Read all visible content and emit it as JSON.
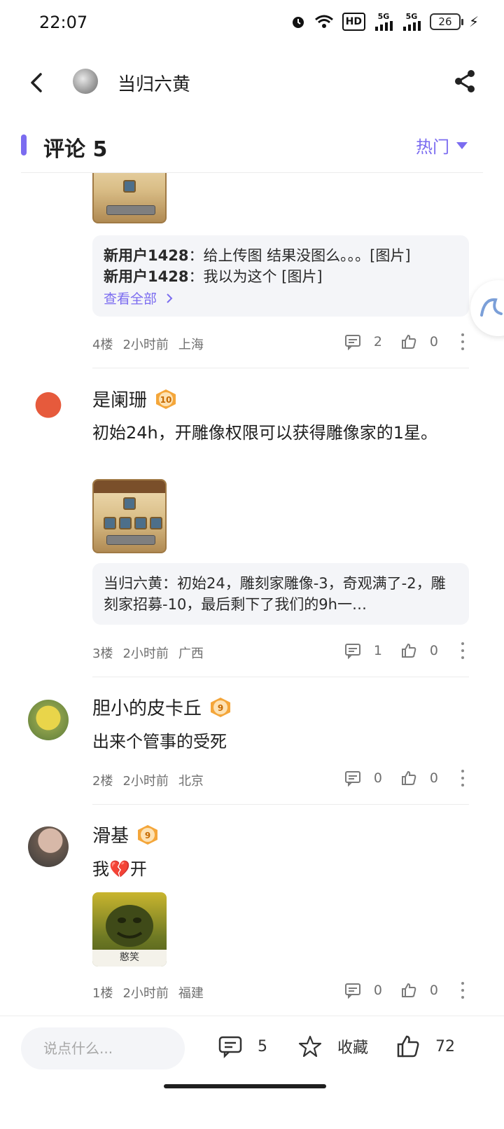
{
  "status_bar": {
    "time": "22:07",
    "hd_label": "HD",
    "net_label_1": "5G",
    "net_label_2": "5G",
    "battery": "26"
  },
  "header": {
    "author": "当归六黄"
  },
  "comments_header": {
    "title": "评论 5",
    "sort_label": "热门"
  },
  "comments": [
    {
      "replies": [
        {
          "user": "新用户1428",
          "text": "：给上传图 结果没图么。。。[图片]"
        },
        {
          "user": "新用户1428",
          "text": "：我以为这个 [图片]"
        }
      ],
      "see_all": "查看全部",
      "floor": "4楼",
      "time": "2小时前",
      "location": "上海",
      "reply_count": "2",
      "like_count": "0"
    },
    {
      "username": "是阑珊",
      "level": "10",
      "text": "初始24h，开雕像权限可以获得雕像家的1星。",
      "reply": {
        "user": "当归六黄",
        "text": "：初始24，雕刻家雕像-3，奇观满了-2，雕刻家招募-10，最后剩下了我们的9h一…"
      },
      "floor": "3楼",
      "time": "2小时前",
      "location": "广西",
      "reply_count": "1",
      "like_count": "0"
    },
    {
      "username": "胆小的皮卡丘",
      "level": "9",
      "text": "出来个管事的受死",
      "floor": "2楼",
      "time": "2小时前",
      "location": "北京",
      "reply_count": "0",
      "like_count": "0"
    },
    {
      "username": "滑基",
      "level": "9",
      "text": "我💔开",
      "image_caption": "憨笑",
      "floor": "1楼",
      "time": "2小时前",
      "location": "福建",
      "reply_count": "0",
      "like_count": "0"
    }
  ],
  "bottom_bar": {
    "input_placeholder": "说点什么...",
    "comment_count": "5",
    "favorite_label": "收藏",
    "like_count": "72"
  },
  "colors": {
    "accent": "#7b6cf0",
    "badge": "#f4a63a",
    "text": "#1f1f1f",
    "muted": "#6f6f6f"
  }
}
